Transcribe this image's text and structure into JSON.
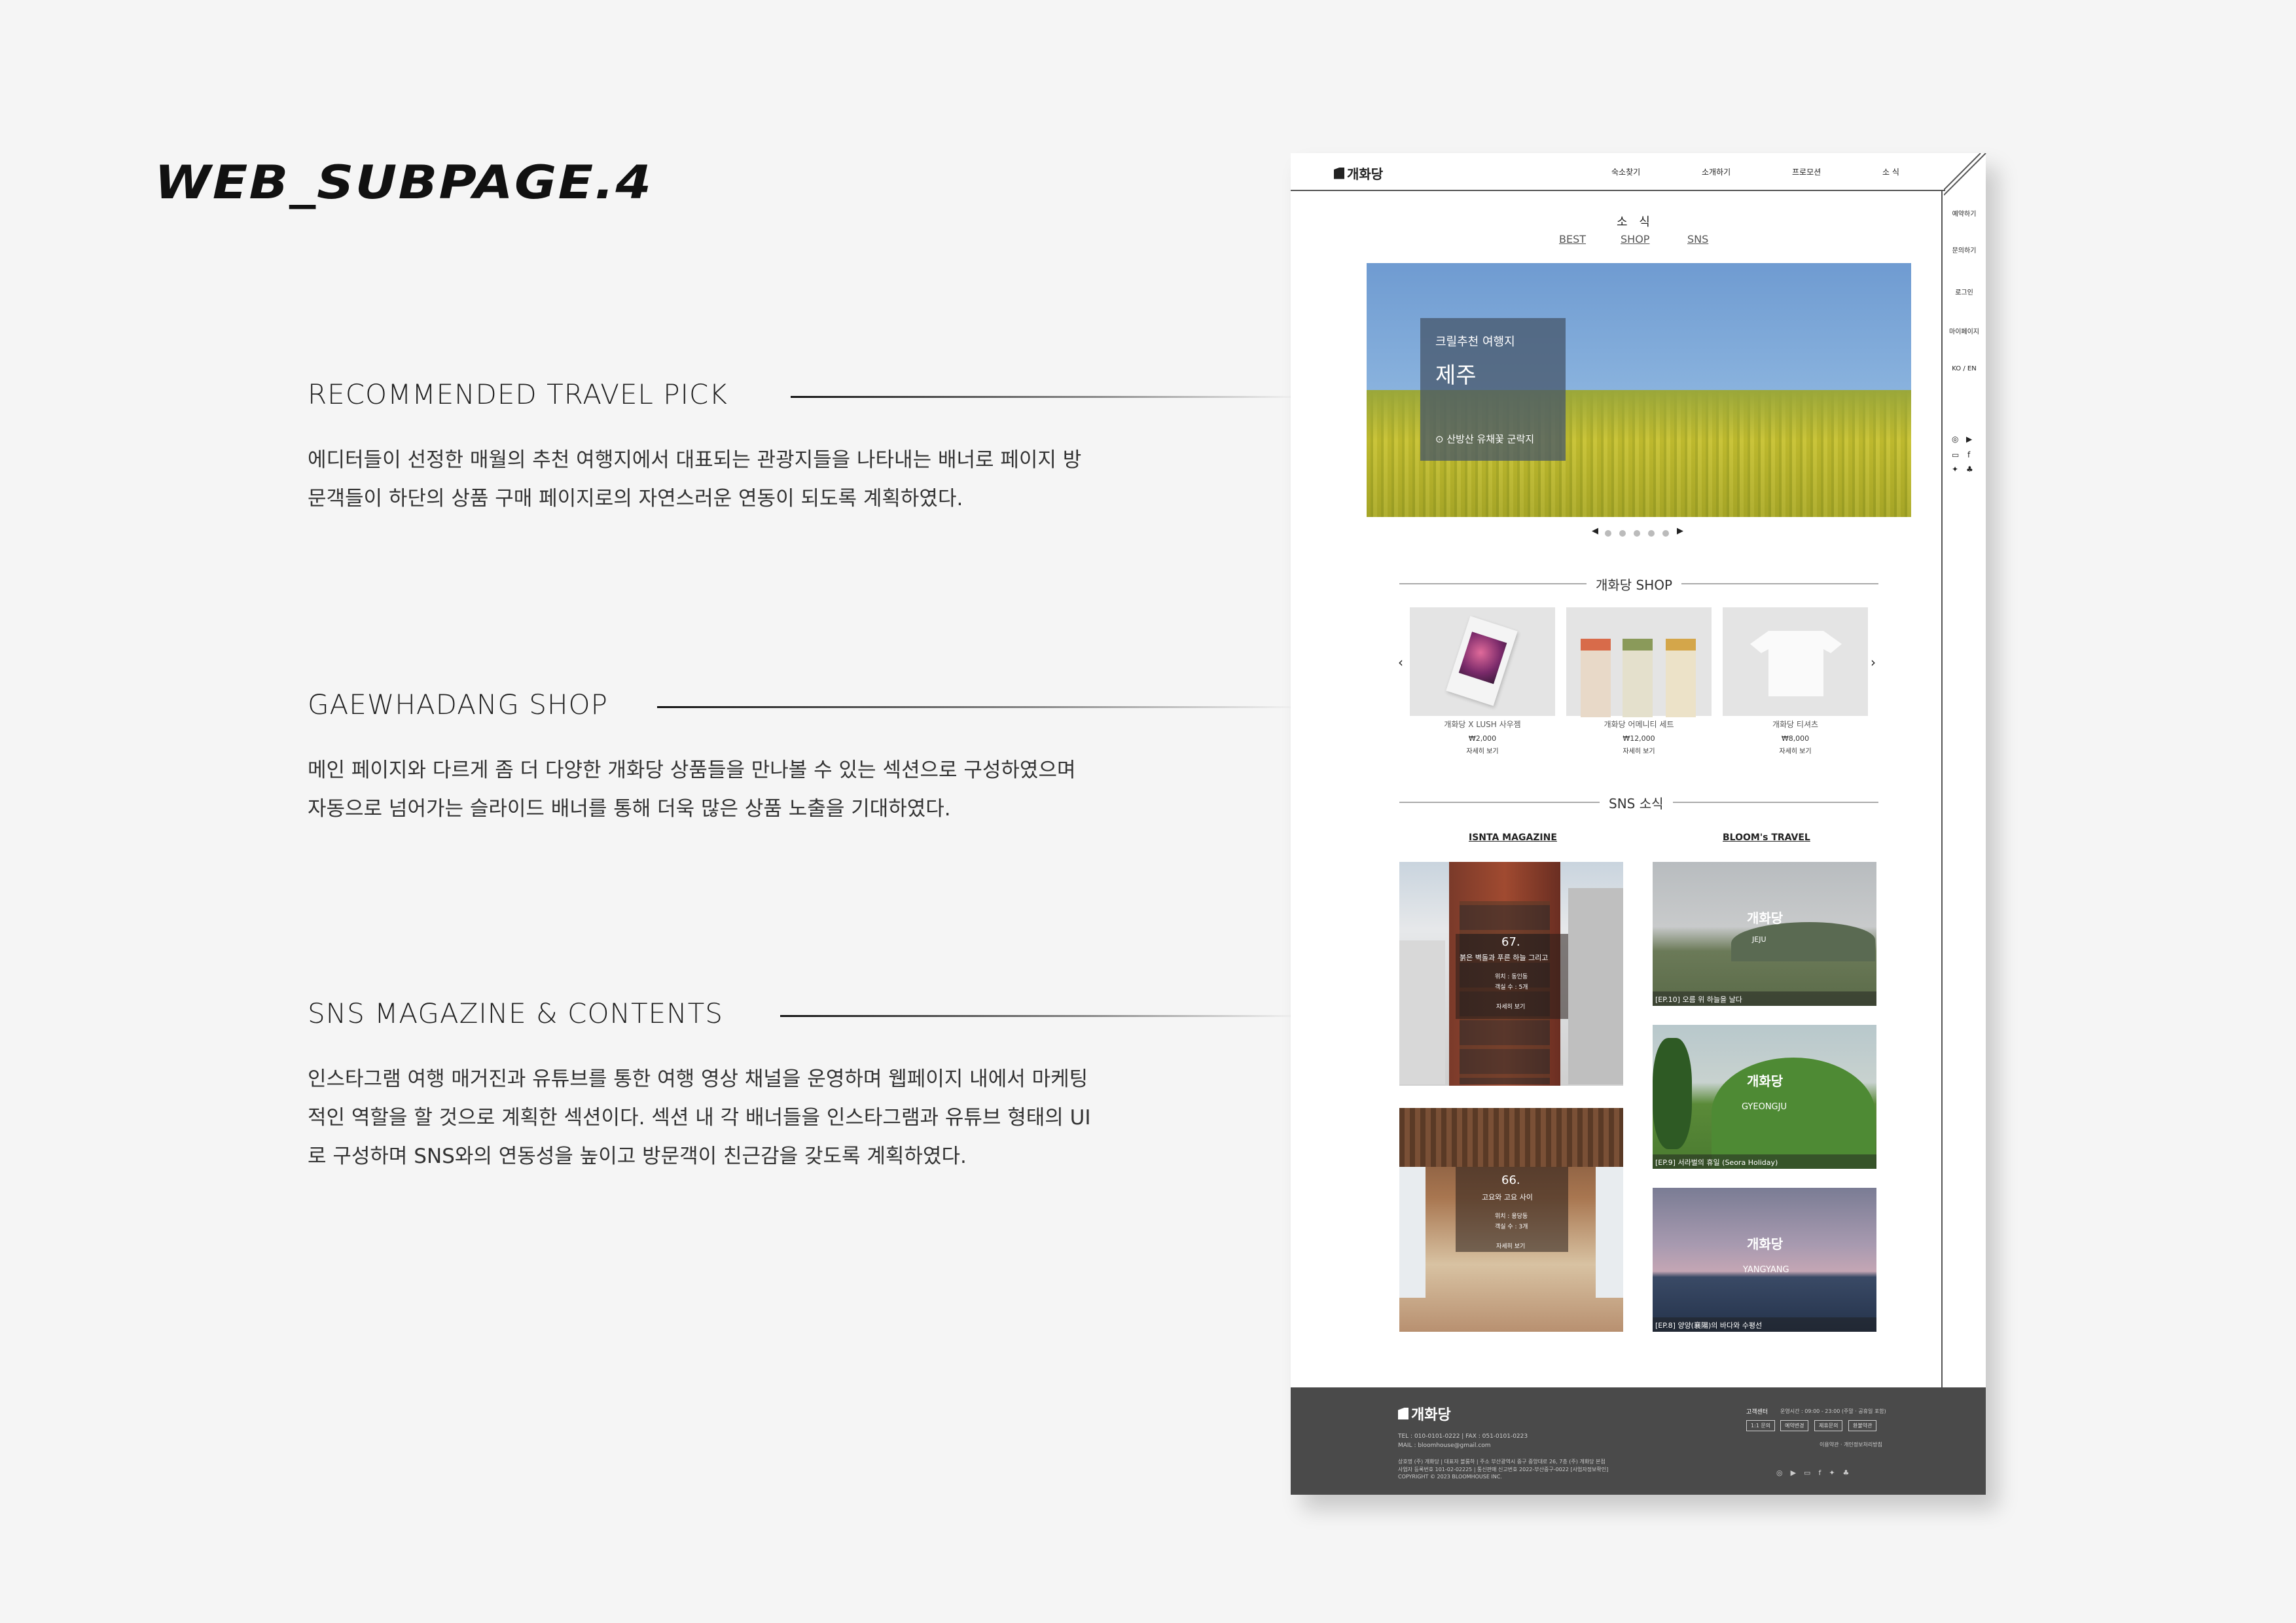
{
  "page_title": "WEB_SUBPAGE.4",
  "sections": [
    {
      "heading": "RECOMMENDED TRAVEL PICK",
      "lines": [
        "에디터들이 선정한 매월의 추천 여행지에서 대표되는 관광지들을 나타내는 배너로 페이지 방",
        "문객들이 하단의 상품 구매 페이지로의 자연스러운 연동이 되도록 계획하였다."
      ]
    },
    {
      "heading": "GAEWHADANG SHOP",
      "lines": [
        "메인 페이지와 다르게 좀 더 다양한 개화당 상품들을 만나볼 수 있는 섹션으로 구성하였으며",
        "자동으로 넘어가는 슬라이드 배너를 통해 더욱 많은 상품 노출을 기대하였다."
      ]
    },
    {
      "heading": "SNS MAGAZINE & CONTENTS",
      "lines": [
        "인스타그램 여행 매거진과 유튜브를 통한 여행 영상 채널을 운영하며 웹페이지 내에서 마케팅",
        "적인 역할을 할 것으로 계획한 섹션이다. 섹션 내 각 배너들을 인스타그램과 유튜브 형태의 UI",
        "로 구성하며 SNS와의 연동성을 높이고 방문객이 친근감을 갖도록 계획하였다."
      ]
    }
  ],
  "mockup": {
    "logo": "개화당",
    "nav": [
      "숙소찾기",
      "소개하기",
      "프로모션",
      "소 식"
    ],
    "side_menu": [
      "예약하기",
      "문의하기",
      "로그인",
      "마이페이지",
      "KO / EN"
    ],
    "sub_title": "소 식",
    "sub_tabs": [
      "BEST",
      "SHOP",
      "SNS"
    ],
    "hero": {
      "subtitle": "크릴추천 여행지",
      "title": "제주",
      "location": "산방산 유채꽃 군락지"
    },
    "shop_label": "개화당 SHOP",
    "products": [
      {
        "name": "개화당 X LUSH 사우젬",
        "price": "₩2,000",
        "more": "자세히 보기"
      },
      {
        "name": "개화당 어메니티 세트",
        "price": "₩12,000",
        "more": "자세히 보기"
      },
      {
        "name": "개화당 티셔츠",
        "price": "₩8,000",
        "more": "자세히 보기"
      }
    ],
    "sns_label": "SNS 소식",
    "insta_label": "ISNTA MAGAZINE",
    "bloom_label": "BLOOM's TRAVEL",
    "insta_tiles": [
      {
        "num": "67.",
        "caption": "붉은 벽돌과 푸른 하늘 그리고",
        "lines": [
          "위치 : 동인동",
          "객실 수 : 5개",
          "자세히 보기"
        ]
      },
      {
        "num": "66.",
        "caption": "고요와 고요 사이",
        "lines": [
          "위치 : 용당동",
          "객실 수 : 3개",
          "자세히 보기"
        ]
      }
    ],
    "bloom_tiles": [
      {
        "brand": "개화당",
        "place": "JEJU",
        "ep": "[EP.10] 오름 위 하늘을 날다"
      },
      {
        "brand": "개화당",
        "place": "GYEONGJU",
        "ep": "[EP.9] 서라벌의 휴일 (Seora Holiday)"
      },
      {
        "brand": "개화당",
        "place": "YANGYANG",
        "ep": "[EP.8] 양양(襄陽)의 바다와 수평선"
      }
    ],
    "footer": {
      "logo": "개화당",
      "tel": "TEL : 010-0101-0222  |  FAX : 051-0101-0223",
      "mail": "MAIL : bloomhouse@gmail.com",
      "info1": "상호명 (주) 개화당  |  대표자 블룸하  |  주소 부산광역시 중구 중앙대로 26, 7층 (주) 개화당 본점",
      "info2": "사업자 등록번호 101-02-02225  |  통신판매 신고번호 2022-부산중구-0022 [사업자정보확인]",
      "copyright": "COPYRIGHT © 2023 BLOOMHOUSE INC.",
      "cs_title": "고객센터",
      "cs_hours": "운영시간 : 09:00 - 23:00 (주말 · 공휴일 포함)",
      "buttons": [
        "1:1 문의",
        "예약변경",
        "제휴문의",
        "환불약관"
      ],
      "policy": "이용약관 · 개인정보처리방침"
    }
  },
  "colors": {
    "bg": "#f5f5f5",
    "footer": "#4a4a4a",
    "hero_card": "#465569"
  }
}
